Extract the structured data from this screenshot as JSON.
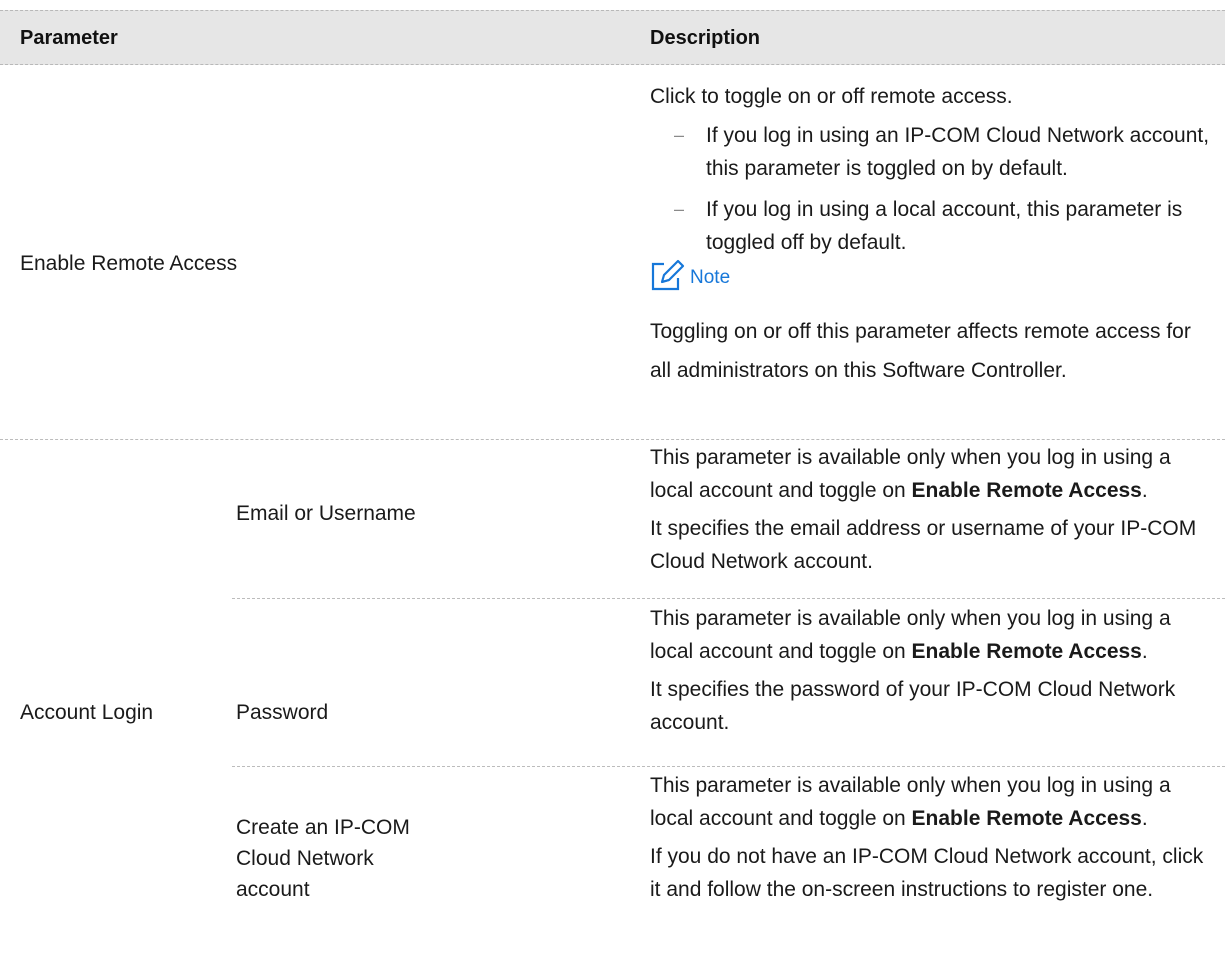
{
  "header": {
    "parameter": "Parameter",
    "description": "Description"
  },
  "rows": {
    "remote": {
      "parameter": "Enable Remote Access",
      "intro": "Click to toggle on or off remote access.",
      "bullets": [
        "If you log in using an IP-COM Cloud Network account, this parameter is toggled on by default.",
        "If you log in using a local account, this parameter is toggled off by default."
      ],
      "bullet_mark": "–",
      "note_label": "Note",
      "note_icon": "note-pencil-icon",
      "note_text": "Toggling on or off this parameter affects remote access for all administrators on this Software Controller."
    },
    "account": {
      "parameter": "Account Login",
      "subrows": [
        {
          "name": "Email or Username",
          "line1_pre": "This parameter is available only when you log in using a local account and toggle on ",
          "line1_bold": "Enable Remote Access",
          "line1_post": ".",
          "line2": "It specifies the email address or username of your IP-COM Cloud Network account."
        },
        {
          "name": "Password",
          "line1_pre": "This parameter is available only when you log in using a local account and toggle on ",
          "line1_bold": "Enable Remote Access",
          "line1_post": ".",
          "line2": "It specifies the password of your IP-COM Cloud Network account."
        },
        {
          "name": "Create an IP-COM Cloud Network account",
          "line1_pre": "This parameter is available only when you log in using a local account and toggle on ",
          "line1_bold": "Enable Remote Access",
          "line1_post": ".",
          "line2": "If you do not have an IP-COM Cloud Network account, click it and follow the on-screen instructions to register one."
        }
      ]
    }
  },
  "colors": {
    "header_bg": "#e6e6e6",
    "note_accent": "#1677d9",
    "rule": "#bcbcbc"
  }
}
